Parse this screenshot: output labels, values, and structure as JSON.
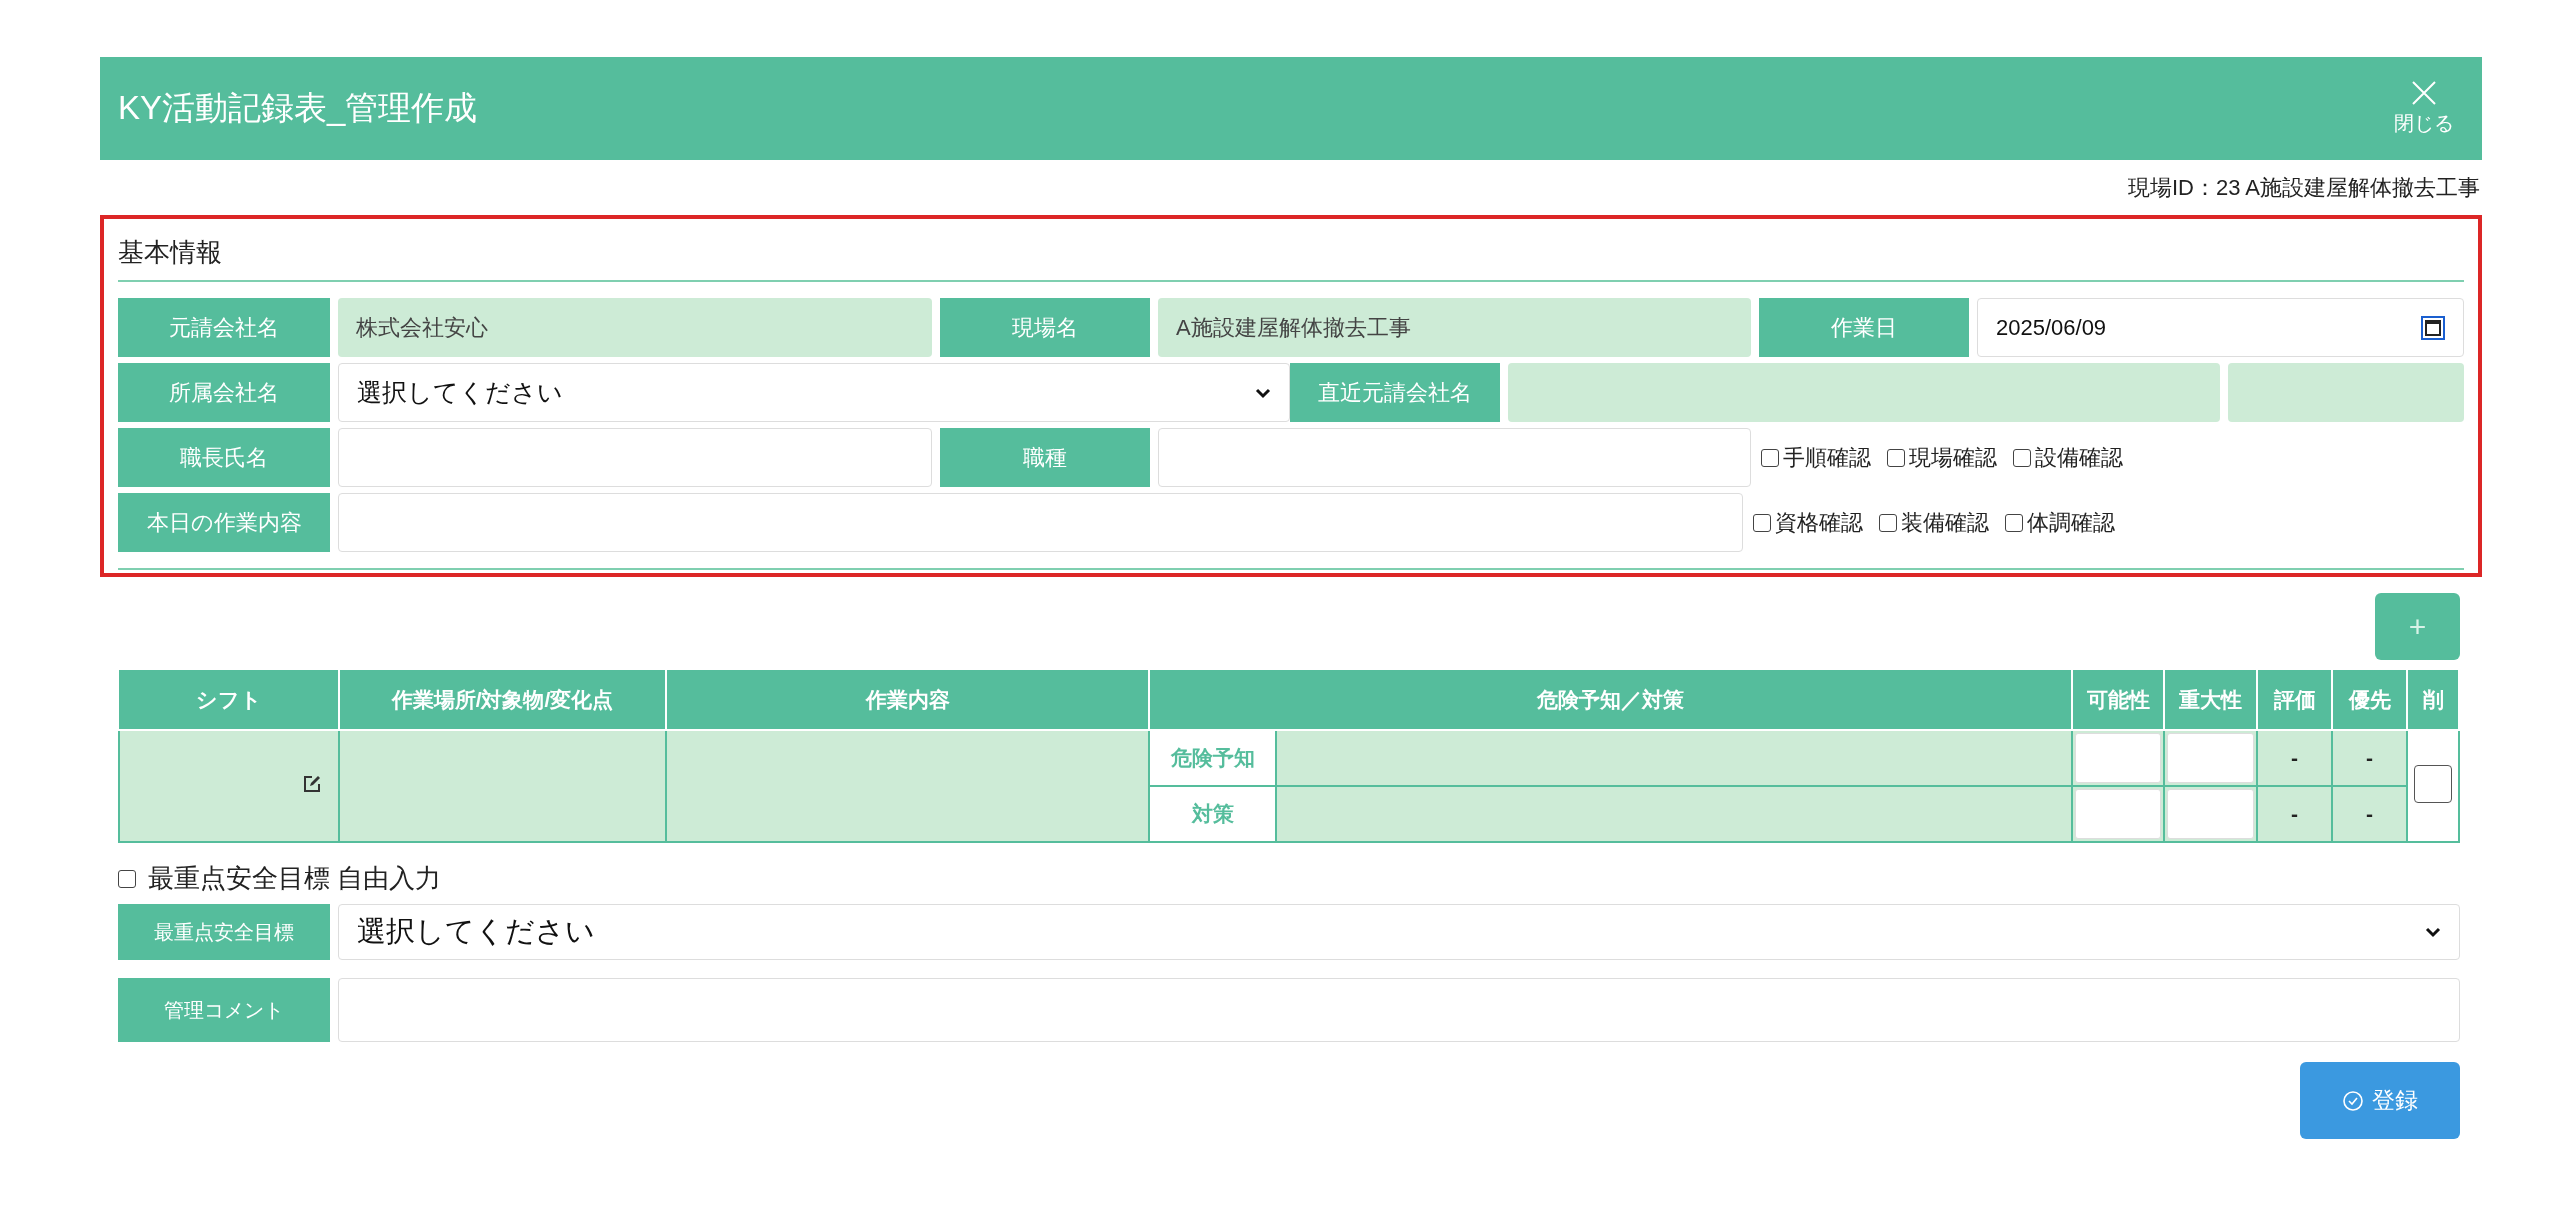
{
  "header": {
    "title": "KY活動記録表_管理作成",
    "close_label": "閉じる"
  },
  "site_id": "現場ID：23 A施設建屋解体撤去工事",
  "basic_info": {
    "title": "基本情報",
    "prime_contractor": {
      "label": "元請会社名",
      "value": "株式会社安心"
    },
    "site_name": {
      "label": "現場名",
      "value": "A施設建屋解体撤去工事"
    },
    "work_date": {
      "label": "作業日",
      "value": "2025/06/09"
    },
    "affiliated_company": {
      "label": "所属会社名",
      "value": "選択してください"
    },
    "recent_prime": {
      "label": "直近元請会社名"
    },
    "foreman": {
      "label": "職長氏名"
    },
    "trade": {
      "label": "職種"
    },
    "todays_work": {
      "label": "本日の作業内容"
    },
    "checks": [
      {
        "label": "手順確認",
        "checked": false
      },
      {
        "label": "現場確認",
        "checked": false
      },
      {
        "label": "設備確認",
        "checked": false
      },
      {
        "label": "資格確認",
        "checked": false
      },
      {
        "label": "装備確認",
        "checked": false
      },
      {
        "label": "体調確認",
        "checked": false
      }
    ]
  },
  "add_button": "+",
  "table": {
    "columns": [
      "シフト",
      "作業場所/対象物/変化点",
      "作業内容",
      "危険予知／対策",
      "可能性",
      "重大性",
      "評価",
      "優先",
      "削"
    ],
    "rows": [
      {
        "delete_checked": false,
        "lines": [
          {
            "label": "危険予知",
            "evaluation": "-",
            "priority": "-"
          },
          {
            "label": "対策",
            "evaluation": "-",
            "priority": "-"
          }
        ]
      }
    ]
  },
  "free_input": {
    "label": "最重点安全目標 自由入力",
    "checked": false
  },
  "safety_goal": {
    "label": "最重点安全目標",
    "value": "選択してください"
  },
  "comment": {
    "label": "管理コメント"
  },
  "register_button": "登録"
}
